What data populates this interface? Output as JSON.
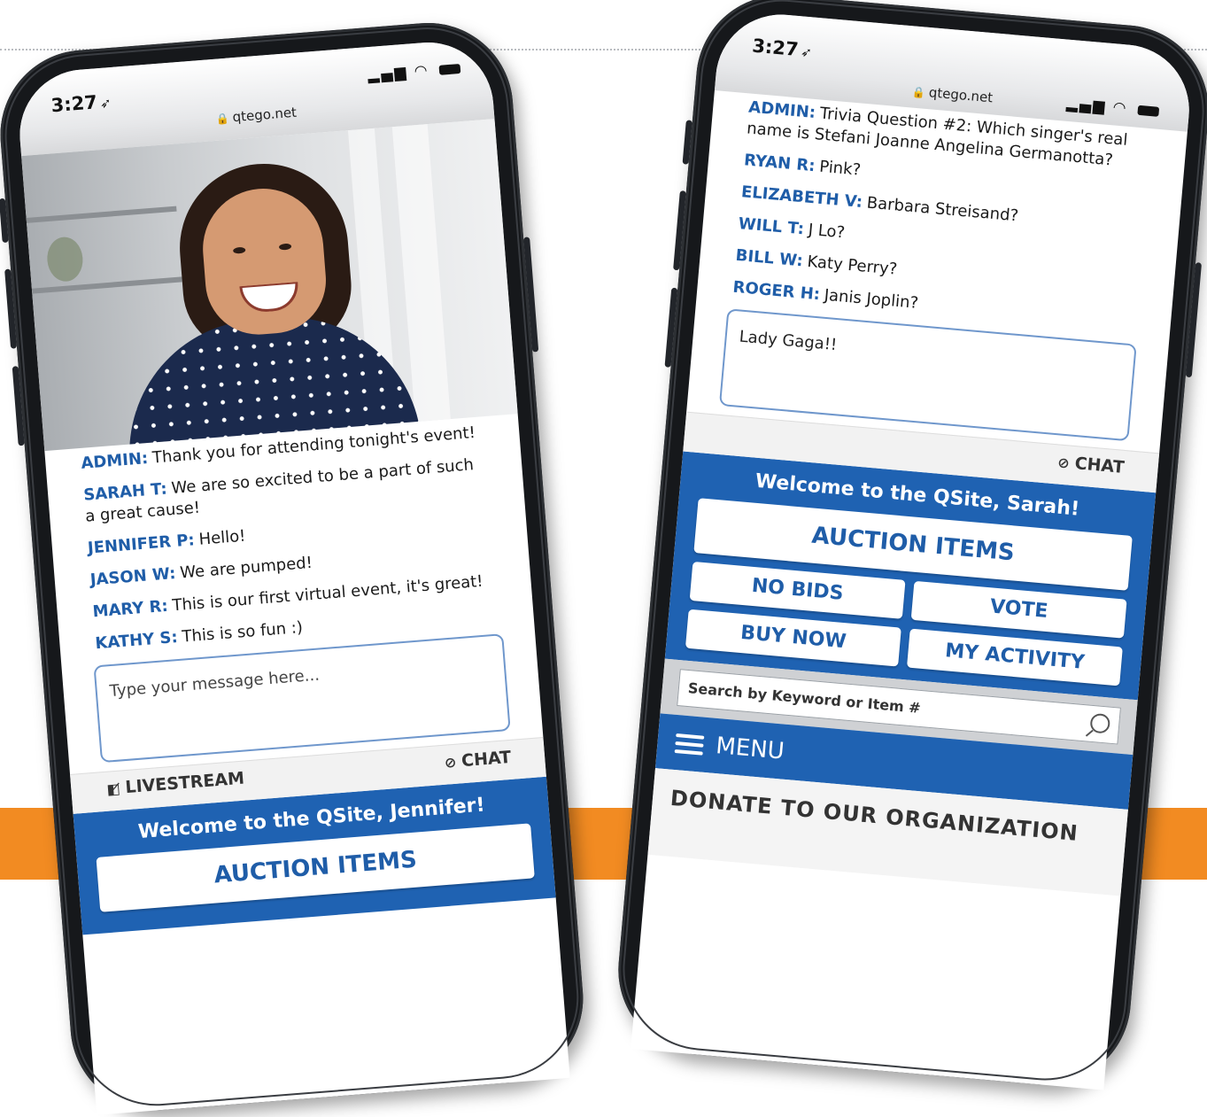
{
  "phone_left": {
    "status": {
      "time": "3:27",
      "url": "qtego.net"
    },
    "chat": [
      {
        "user": "ADMIN:",
        "text": "Thank you for attending tonight's event!"
      },
      {
        "user": "SARAH T:",
        "text": "We are so excited to be a part of such a great cause!"
      },
      {
        "user": "JENNIFER P:",
        "text": "Hello!"
      },
      {
        "user": "JASON W:",
        "text": "We are pumped!"
      },
      {
        "user": "MARY R:",
        "text": "This is our first virtual event, it's great!"
      },
      {
        "user": "KATHY S:",
        "text": "This is so fun :)"
      }
    ],
    "input_placeholder": "Type your message here...",
    "chat_toggle": "CHAT",
    "livestream_toggle": "LIVESTREAM",
    "welcome": "Welcome to the QSite, Jennifer!",
    "auction_items": "AUCTION ITEMS"
  },
  "phone_right": {
    "status": {
      "time": "3:27",
      "url": "qtego.net"
    },
    "chat": [
      {
        "user": "ADMIN:",
        "text": "Trivia Question #2: Which singer's real name is Stefani Joanne Angelina Germanotta?"
      },
      {
        "user": "RYAN R:",
        "text": "Pink?"
      },
      {
        "user": "ELIZABETH V:",
        "text": "Barbara Streisand?"
      },
      {
        "user": "WILL T:",
        "text": "J Lo?"
      },
      {
        "user": "BILL W:",
        "text": "Katy Perry?"
      },
      {
        "user": "ROGER H:",
        "text": "Janis Joplin?"
      }
    ],
    "input_value": "Lady Gaga!!",
    "chat_toggle": "CHAT",
    "welcome": "Welcome to the QSite, Sarah!",
    "auction_items": "AUCTION ITEMS",
    "no_bids": "NO BIDS",
    "vote": "VOTE",
    "buy_now": "BUY NOW",
    "my_activity": "MY ACTIVITY",
    "search_placeholder": "Search by Keyword or Item #",
    "menu": "MENU",
    "donate": "DONATE TO OUR ORGANIZATION"
  },
  "colors": {
    "brand_blue": "#1f62b2",
    "accent_orange": "#f28b22",
    "phone_body": "#16181b"
  }
}
